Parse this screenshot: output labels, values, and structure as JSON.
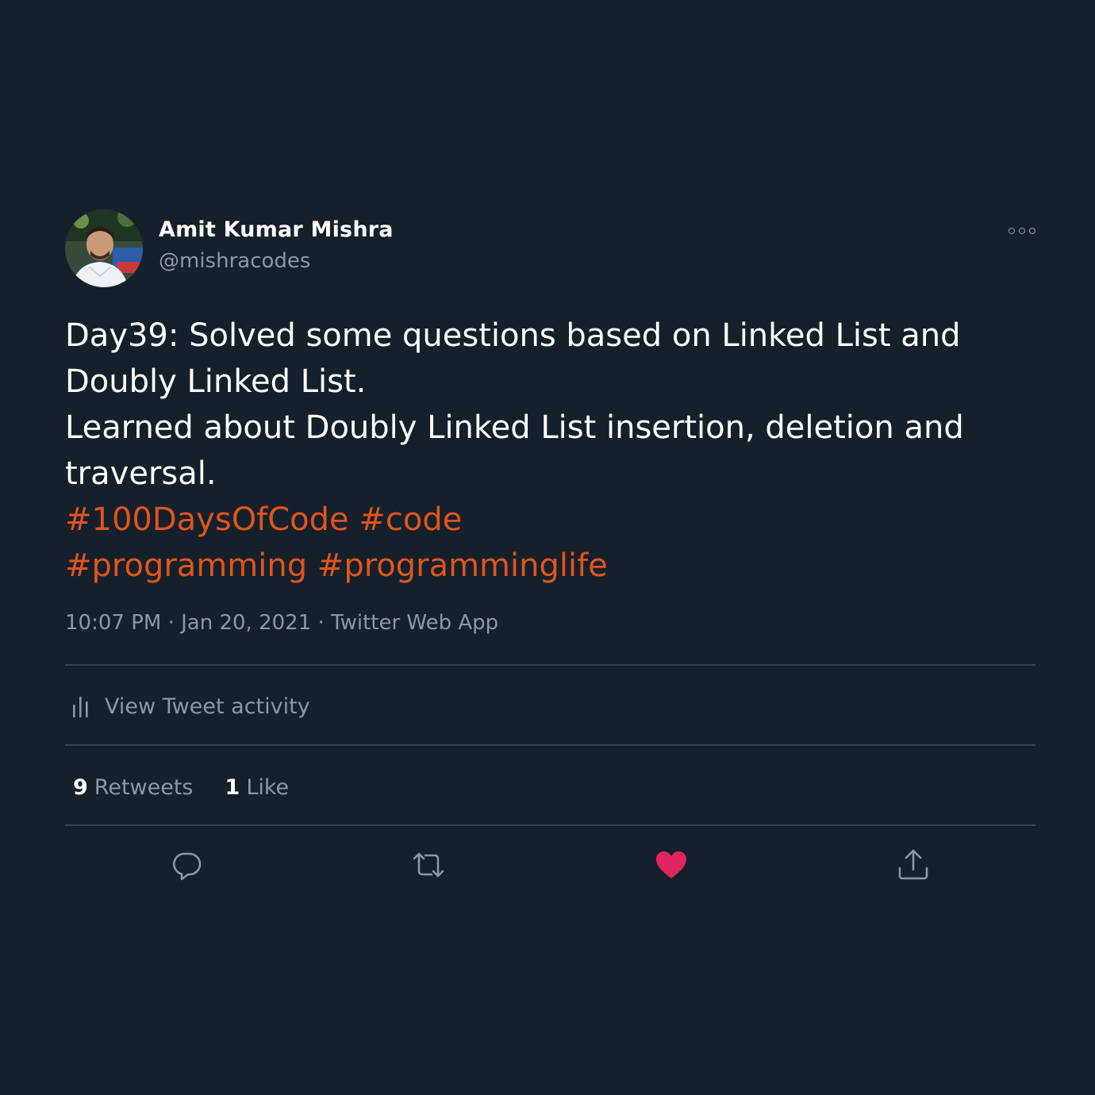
{
  "author": {
    "name": "Amit Kumar Mishra",
    "handle": "@mishracodes",
    "avatar_icon": "profile-photo"
  },
  "tweet": {
    "lines": [
      "Day39: Solved some questions based on Linked List and",
      "Doubly Linked List.",
      "Learned about Doubly Linked List insertion, deletion and",
      "traversal."
    ],
    "hashtags_line1": [
      "#100DaysOfCode",
      "#code"
    ],
    "hashtags_line2": [
      "#programming",
      "#programminglife"
    ],
    "time": "10:07 PM",
    "separator": "·",
    "date": "Jan 20, 2021",
    "source": "Twitter Web App"
  },
  "activity": {
    "label": "View Tweet activity",
    "icon": "bar-chart-icon"
  },
  "stats": {
    "retweets_count": "9",
    "retweets_label": "Retweets",
    "likes_count": "1",
    "likes_label": "Like"
  },
  "actions": {
    "reply_icon": "reply-icon",
    "retweet_icon": "retweet-icon",
    "like_icon": "heart-icon",
    "share_icon": "share-icon"
  },
  "colors": {
    "background": "#15202b",
    "hashtag": "#e0551c",
    "muted": "#8899a6",
    "divider": "#38444d",
    "liked": "#e0245e"
  }
}
